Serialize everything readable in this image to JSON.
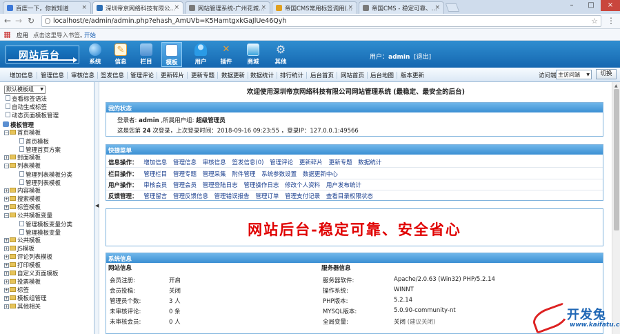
{
  "browser": {
    "tabs": [
      {
        "title": "百度一下，你就知道",
        "active": false,
        "icon_color": "#3b77d8"
      },
      {
        "title": "深圳帝京网络科技有限公...",
        "active": true,
        "icon_color": "#2d6fb5"
      },
      {
        "title": "网站管理系统-广州花城...",
        "active": false,
        "icon_color": "#7a7a7a"
      },
      {
        "title": "帝国CMS常用标签调用(...",
        "active": false,
        "icon_color": "#e0a020"
      },
      {
        "title": "帝国CMS - 稳定可靠、...",
        "active": false,
        "icon_color": "#7a7a7a"
      }
    ],
    "url": "localhost/e/admin/admin.php?ehash_AmUVb=K5HamtgxkGaJlUe46Qyh",
    "bookmarks": {
      "apps": "应用",
      "hint": "点击这里导入书签。",
      "start": "开始"
    }
  },
  "header": {
    "logo_text": "网站后台",
    "nav": [
      {
        "label": "系统",
        "icon": "globe-icon",
        "color": "#1f7fd0"
      },
      {
        "label": "信息",
        "icon": "pencil-icon",
        "color": "#e7a23a"
      },
      {
        "label": "栏目",
        "icon": "folder-icon",
        "color": "#4f8fd0"
      },
      {
        "label": "模板",
        "icon": "template-icon",
        "color": "#6fa9df",
        "active": true
      },
      {
        "label": "用户",
        "icon": "user-icon",
        "color": "#2a9be6"
      },
      {
        "label": "插件",
        "icon": "tools-icon",
        "color": "#e58420"
      },
      {
        "label": "商城",
        "icon": "shop-icon",
        "color": "#37a3dc"
      },
      {
        "label": "其他",
        "icon": "gear-icon",
        "color": "#9aa9ba"
      }
    ],
    "user_prefix": "用户：",
    "username": "admin",
    "logout": "[退出]"
  },
  "subnav": {
    "items": [
      "增加信息",
      "管理信息",
      "审核信息",
      "签发信息",
      "管理评论",
      "更新碎片",
      "更新专题",
      "数据更新",
      "数据统计",
      "排行统计",
      "后台首页",
      "网站首页",
      "后台地图",
      "版本更新"
    ],
    "visit_label": "访问端:",
    "visit_value": "主访问端",
    "switch_label": "切换"
  },
  "sidebar": {
    "select_value": "默认模板组",
    "rows": [
      {
        "label": "查看标签语法",
        "type": "doc"
      },
      {
        "label": "自动生成标签",
        "type": "doc"
      },
      {
        "label": "动态页面模板管理",
        "type": "doc"
      },
      {
        "label": "模板管理",
        "type": "root"
      },
      {
        "label": "首页模板",
        "type": "folder-open"
      },
      {
        "label": "首页模板",
        "type": "leaf"
      },
      {
        "label": "管理首页方案",
        "type": "leaf"
      },
      {
        "label": "封面模板",
        "type": "folder"
      },
      {
        "label": "列表模板",
        "type": "folder-open"
      },
      {
        "label": "管理列表模板分类",
        "type": "leaf"
      },
      {
        "label": "管理列表模板",
        "type": "leaf"
      },
      {
        "label": "内容模板",
        "type": "folder"
      },
      {
        "label": "搜索模板",
        "type": "folder"
      },
      {
        "label": "标签模板",
        "type": "folder"
      },
      {
        "label": "公共模板变量",
        "type": "folder-open"
      },
      {
        "label": "管理模板变量分类",
        "type": "leaf"
      },
      {
        "label": "管理模板变量",
        "type": "leaf"
      },
      {
        "label": "公共模板",
        "type": "folder"
      },
      {
        "label": "JS模板",
        "type": "folder"
      },
      {
        "label": "评论列表模板",
        "type": "folder"
      },
      {
        "label": "打印模板",
        "type": "folder"
      },
      {
        "label": "自定义页面模板",
        "type": "folder"
      },
      {
        "label": "投票模板",
        "type": "folder"
      },
      {
        "label": "标签",
        "type": "folder"
      },
      {
        "label": "模板组管理",
        "type": "folder"
      },
      {
        "label": "其他相关",
        "type": "folder"
      }
    ]
  },
  "main": {
    "welcome": "欢迎使用深圳帝京网络科技有限公司网站管理系统 (最稳定、最安全的后台)",
    "status": {
      "title": "我的状态",
      "login_prefix": "登录者:",
      "login_user": "admin",
      "group_prefix": ",所属用户组:",
      "group": "超级管理员",
      "stats_a": "这是您第",
      "count": "24",
      "stats_b": "次登录，上次登录时间：2018-09-16 09:23:55 ，登录IP：127.0.0.1:49566"
    },
    "quick": {
      "title": "快捷菜单",
      "rows": [
        {
          "label": "信息操作：",
          "links": [
            "增加信息",
            "管理信息",
            "审核信息",
            "签发信息(0)",
            "管理评论",
            "更新碎片",
            "更新专题",
            "数据统计"
          ]
        },
        {
          "label": "栏目操作：",
          "links": [
            "管理栏目",
            "管理专题",
            "管理采集",
            "附件管理",
            "系统参数设置",
            "数据更新中心"
          ]
        },
        {
          "label": "用户操作：",
          "links": [
            "审核会员",
            "管理会员",
            "管理登陆日志",
            "管理操作日志",
            "修改个人资料",
            "用户发布统计"
          ]
        },
        {
          "label": "反馈管理：",
          "links": [
            "管理留言",
            "管理反馈信息",
            "管理错误报告",
            "管理订单",
            "管理支付记录",
            "查看目录权限状态"
          ]
        }
      ]
    },
    "banner": "网站后台-稳定可靠、安全省心",
    "sysinfo": {
      "title": "系统信息",
      "left_head": "网站信息",
      "right_head": "服务器信息",
      "left": [
        {
          "k": "会员注册:",
          "v": "开启"
        },
        {
          "k": "会员投稿:",
          "v": "关闭"
        },
        {
          "k": "管理员个数:",
          "v": "3 人"
        },
        {
          "k": "未审核评论:",
          "v": "0 条"
        },
        {
          "k": "未审核会员:",
          "v": "0 人"
        }
      ],
      "right": [
        {
          "k": "服务器软件:",
          "v": "Apache/2.0.63 (Win32) PHP/5.2.14"
        },
        {
          "k": "操作系统:",
          "v": "WINNT"
        },
        {
          "k": "PHP版本:",
          "v": "5.2.14"
        },
        {
          "k": "MYSQL版本:",
          "v": "5.0.90-community-nt"
        },
        {
          "k": "全局变量:",
          "v": "关闭",
          "note": "(建议关闭)"
        }
      ]
    }
  },
  "watermark": {
    "text": "开发兔",
    "url": "www.kaifatu.com"
  }
}
